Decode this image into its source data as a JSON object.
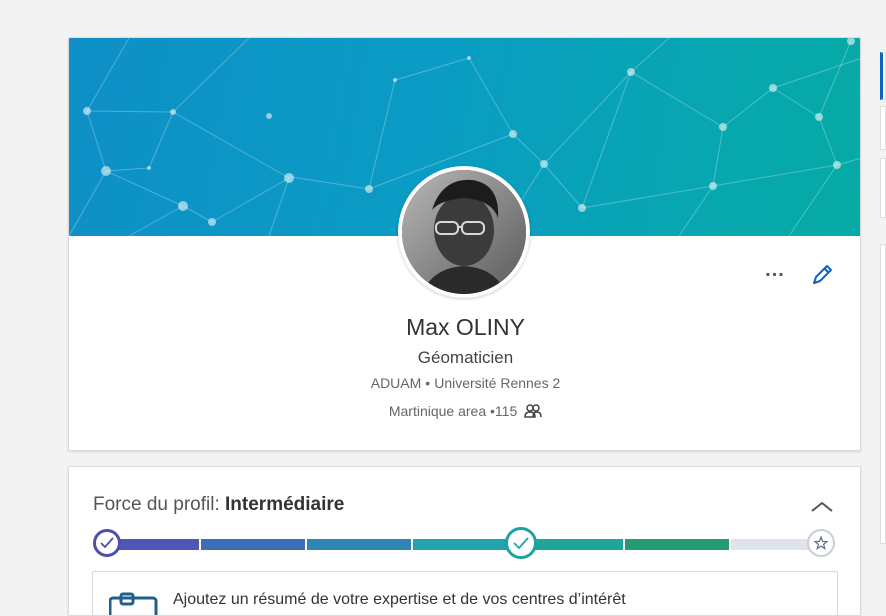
{
  "profile": {
    "name": "Max OLINY",
    "headline": "Géomaticien",
    "company": "ADUAM",
    "school": "Université Rennes 2",
    "location": "Martinique area",
    "connections": "115",
    "separator": "•"
  },
  "actions": {
    "more_label": "...",
    "edit_icon": "pencil-icon"
  },
  "strength": {
    "label": "Force du profil:",
    "level": "Intermédiaire",
    "progress_steps_total": 7,
    "progress_steps_completed": 4,
    "colors": {
      "start": "#5552b8",
      "segments": [
        "#4f56b8",
        "#3e6db7",
        "#2f86b3",
        "#22a3ad",
        "#1ea69a",
        "#249b72",
        "#2b8f55"
      ],
      "remaining": "#dfe4ea",
      "check_active": "#1fa3a0"
    }
  },
  "suggestion": {
    "text": "Ajoutez un résumé de votre expertise et de vos centres d’intérêt"
  }
}
